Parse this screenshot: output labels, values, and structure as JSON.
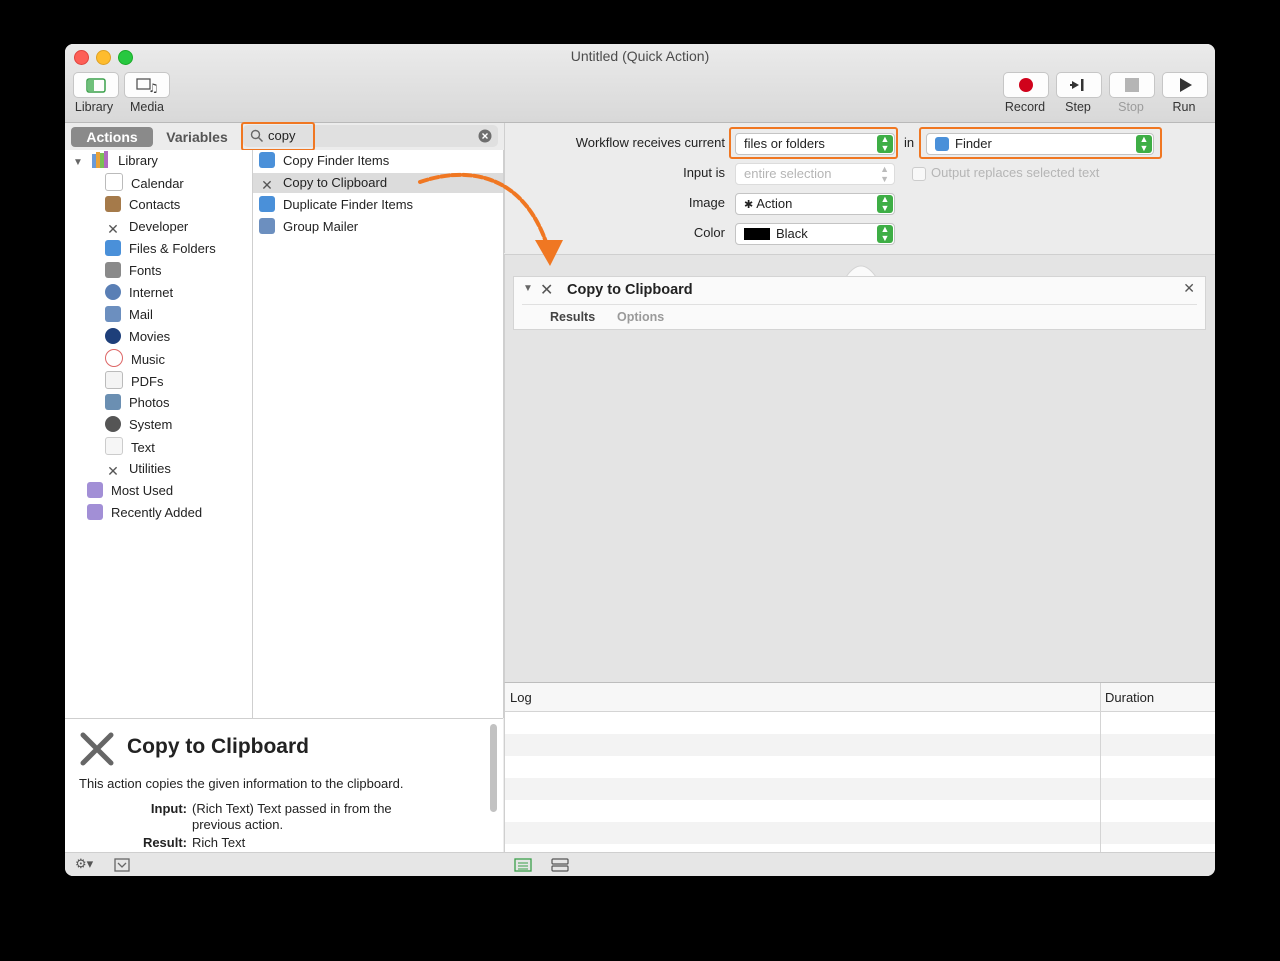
{
  "window": {
    "title": "Untitled (Quick Action)"
  },
  "toolbar": {
    "library_label": "Library",
    "media_label": "Media",
    "record_label": "Record",
    "step_label": "Step",
    "stop_label": "Stop",
    "run_label": "Run"
  },
  "tabs": {
    "actions": "Actions",
    "variables": "Variables"
  },
  "search": {
    "value": "copy"
  },
  "library": {
    "root": "Library",
    "items": [
      "Calendar",
      "Contacts",
      "Developer",
      "Files & Folders",
      "Fonts",
      "Internet",
      "Mail",
      "Movies",
      "Music",
      "PDFs",
      "Photos",
      "System",
      "Text",
      "Utilities"
    ],
    "smart": [
      "Most Used",
      "Recently Added"
    ]
  },
  "actions_list": [
    "Copy Finder Items",
    "Copy to Clipboard",
    "Duplicate Finder Items",
    "Group Mailer"
  ],
  "description": {
    "title": "Copy to Clipboard",
    "summary": "This action copies the given information to the clipboard.",
    "input_label": "Input:",
    "input_text_1": "(Rich Text) Text passed in from the",
    "input_text_2": "previous action.",
    "result_label": "Result:",
    "result_text": "Rich Text"
  },
  "workflow": {
    "receives_label": "Workflow receives current",
    "receives_value": "files or folders",
    "in_label": "in",
    "in_value": "Finder",
    "input_is_label": "Input is",
    "input_is_value": "entire selection",
    "output_replaces": "Output replaces selected text",
    "image_label": "Image",
    "image_value": "Action",
    "color_label": "Color",
    "color_value": "Black"
  },
  "action_card": {
    "title": "Copy to Clipboard",
    "tab_results": "Results",
    "tab_options": "Options"
  },
  "log": {
    "col_log": "Log",
    "col_duration": "Duration"
  },
  "colors": {
    "highlight": "#f07722",
    "selected_row": "#dcdcdc",
    "stepper_green": "#3eae45"
  }
}
